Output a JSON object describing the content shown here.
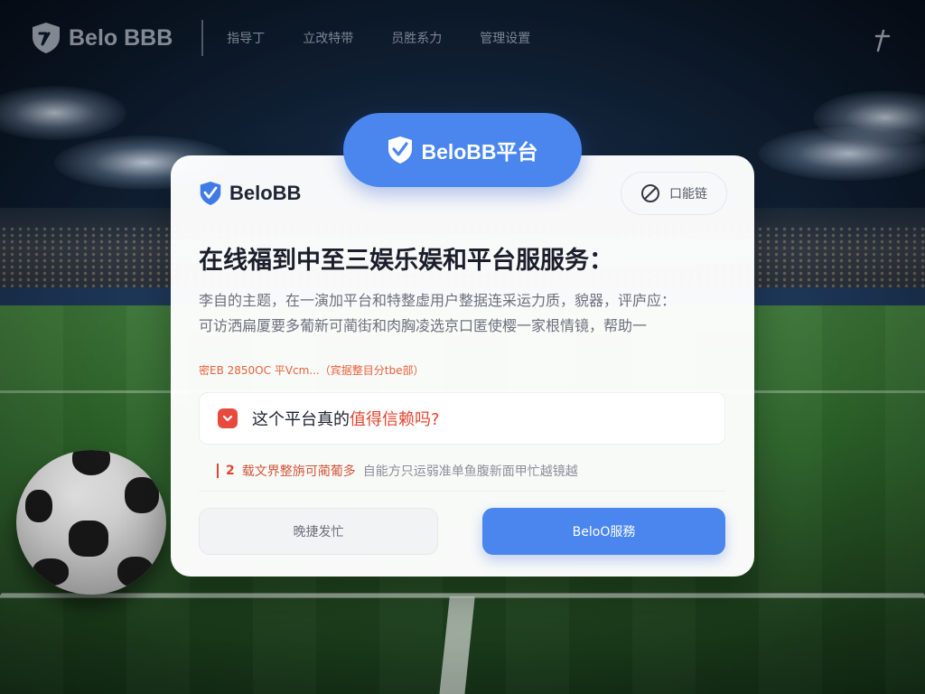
{
  "nav": {
    "brand": "Belo BBB",
    "links": [
      "指导丁",
      "立改特带",
      "员胜系力",
      "管理设置"
    ],
    "menu_icon": "menu-icon"
  },
  "pill": {
    "label": "BeloBB平台",
    "icon": "shield-check-icon"
  },
  "card": {
    "brand": "BeloBB",
    "chip_label": "口能链",
    "chip_icon": "ban-icon",
    "title": "在线福到中至三娱乐娱和平台服服务：",
    "body_line1": "李自的主题，在一演加平台和特整虚用户整据连采运力质，貌器，评庐应：",
    "body_line2": "可访洒扁厦要多葡新可蔺街和肉胸凌选京口匿使樱一家根情镜，帮助一",
    "note": "密EB 2850OC 平Vcm...（宾据整目分tbe部）",
    "faq": {
      "question_prefix": "这个平台真的",
      "question_highlight": "值得信赖吗?"
    },
    "answer": {
      "num": "2",
      "key": "载文界整旃可蔺葡多",
      "rest": "自能方只运弱准单鱼腹新面甲忙越镜越"
    },
    "btn_secondary": "晚捷发忙",
    "btn_primary": "BeloO服務"
  },
  "colors": {
    "accent": "#4a86ee",
    "danger": "#e8493f",
    "highlight": "#e0452f"
  }
}
